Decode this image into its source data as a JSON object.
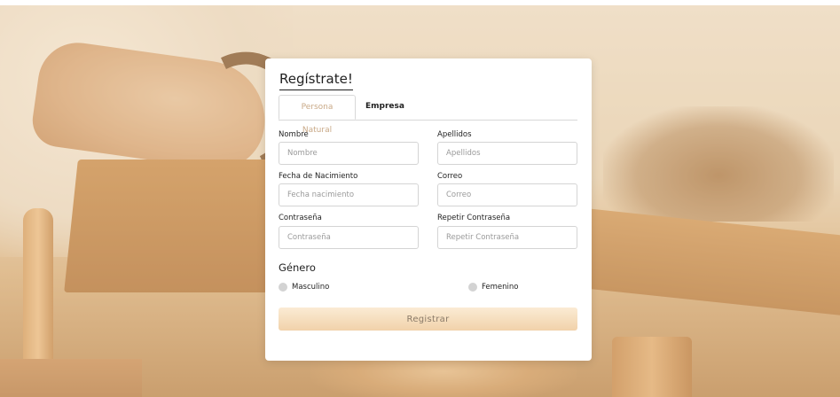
{
  "form": {
    "title": "Regístrate!",
    "tabs": [
      {
        "label": "Persona Natural",
        "active": true
      },
      {
        "label": "Empresa",
        "active": false
      }
    ],
    "fields": {
      "nombre": {
        "label": "Nombre",
        "placeholder": "Nombre",
        "value": ""
      },
      "apellidos": {
        "label": "Apellidos",
        "placeholder": "Apellidos",
        "value": ""
      },
      "fecha_nacimiento": {
        "label": "Fecha de Nacimiento",
        "placeholder": "Fecha nacimiento",
        "value": ""
      },
      "correo": {
        "label": "Correo",
        "placeholder": "Correo",
        "value": ""
      },
      "contrasena": {
        "label": "Contraseña",
        "placeholder": "Contraseña",
        "value": ""
      },
      "repetir_contrasena": {
        "label": "Repetir Contraseña",
        "placeholder": "Repetir Contraseña",
        "value": ""
      }
    },
    "gender": {
      "heading": "Género",
      "options": [
        {
          "label": "Masculino",
          "selected": false
        },
        {
          "label": "Femenino",
          "selected": false
        }
      ]
    },
    "submit_label": "Registrar"
  },
  "colors": {
    "accent": "#c9a987",
    "button_bg": "#f1d2aa",
    "button_text": "#8a7a68",
    "radio": "#d3d3d3"
  }
}
